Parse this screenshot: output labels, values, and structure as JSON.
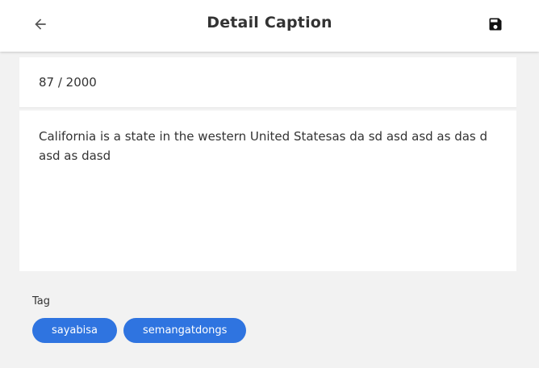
{
  "header": {
    "title": "Detail Caption",
    "back_icon": "arrow-left-icon",
    "save_icon": "floppy-disk-icon"
  },
  "caption": {
    "counter": "87 / 2000",
    "text": "California is a state in the western United Statesas da sd asd asd as das d asd as dasd"
  },
  "tags": {
    "label": "Tag",
    "items": [
      "sayabisa",
      "semangatdongs"
    ]
  },
  "colors": {
    "accent": "#2f74e0",
    "background": "#f2f2f2",
    "card": "#ffffff",
    "text": "#333333"
  }
}
